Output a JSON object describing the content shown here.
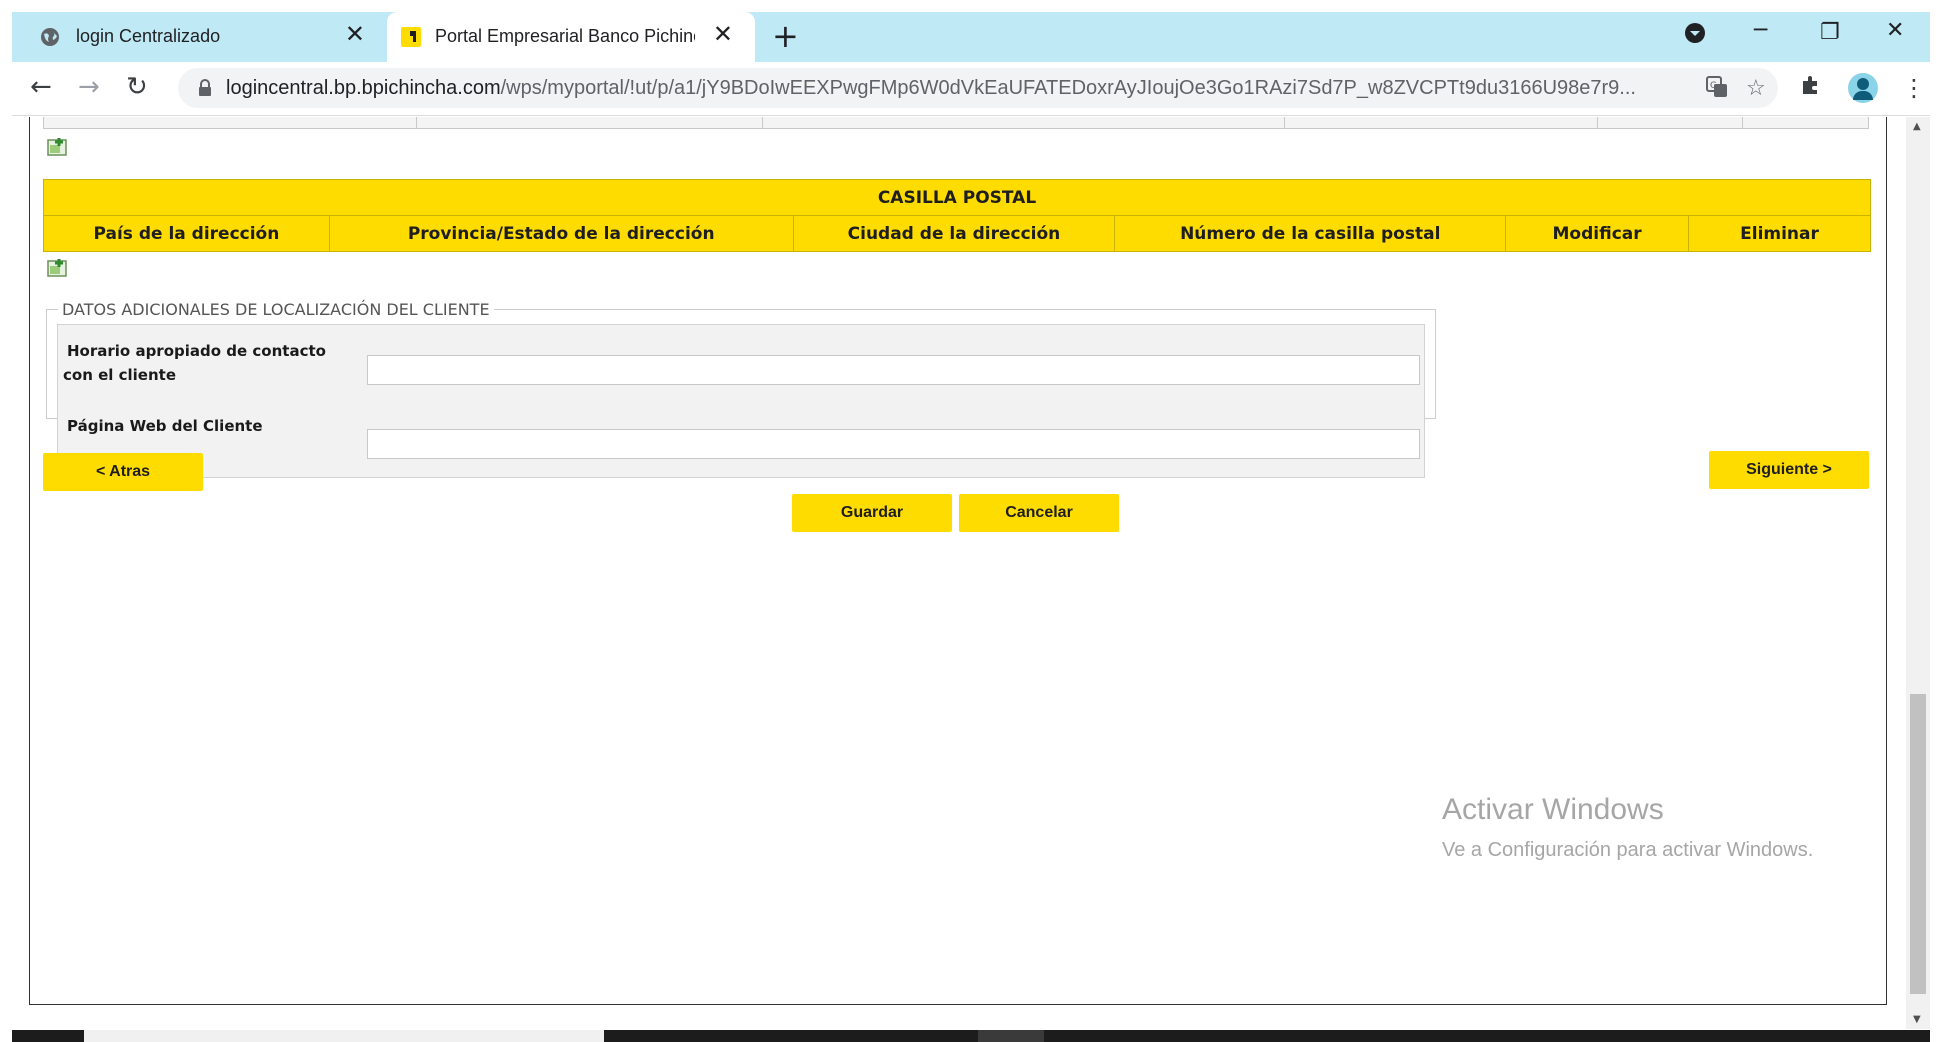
{
  "browser": {
    "tabs": [
      {
        "title": "login Centralizado",
        "active": false,
        "favicon": "globe-icon"
      },
      {
        "title": "Portal Empresarial Banco Pichincha",
        "active": true,
        "favicon": "bank-pichincha-icon"
      }
    ],
    "new_tab_label": "+",
    "url_host": "logincentral.bp.bpichincha.com",
    "url_path": "/wps/myportal/!ut/p/a1/jY9BDoIwEEXPwgFMp6W0dVkEaUFATEDoxrAyJIoujOe3Go1RAzi7Sd7P_w8ZVCPTt9du3166U98e7r9..."
  },
  "postal_box_table": {
    "title": "CASILLA POSTAL",
    "columns": [
      "País de la dirección",
      "Provincia/Estado de la dirección",
      "Ciudad de la dirección",
      "Número de la casilla postal",
      "Modificar",
      "Eliminar"
    ]
  },
  "additional_data": {
    "legend": "DATOS ADICIONALES DE LOCALIZACIÓN DEL CLIENTE",
    "contact_time_label_line1": "Horario apropiado de contacto",
    "contact_time_label_line2": "con el cliente",
    "contact_time_value": "",
    "website_label": "Página Web del Cliente",
    "website_value": ""
  },
  "buttons": {
    "back": "< Atras",
    "next": "Siguiente >",
    "save": "Guardar",
    "cancel": "Cancelar"
  },
  "watermark": {
    "title": "Activar Windows",
    "subtitle": "Ve a Configuración para activar Windows."
  },
  "colors": {
    "brand_yellow": "#ffdc00",
    "tabstrip": "#bfe9f5"
  }
}
